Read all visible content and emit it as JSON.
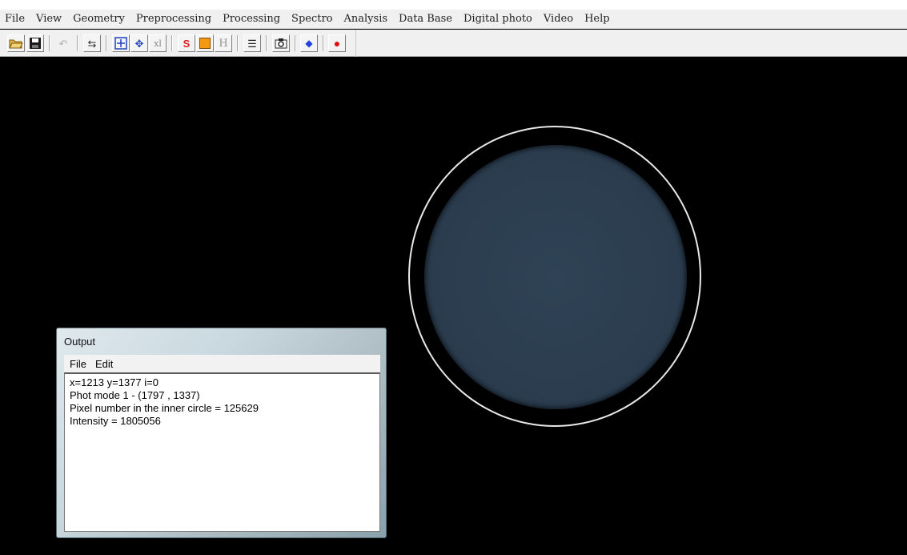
{
  "menubar": {
    "items": [
      "File",
      "View",
      "Geometry",
      "Preprocessing",
      "Processing",
      "Spectro",
      "Analysis",
      "Data Base",
      "Digital photo",
      "Video",
      "Help"
    ]
  },
  "toolbar": {
    "buttons": [
      {
        "name": "open-folder-icon"
      },
      {
        "name": "save-icon"
      },
      {
        "name": "undo-icon",
        "label": "↶"
      },
      {
        "name": "adjust-icon",
        "label": "⇆"
      },
      {
        "name": "zoom-fit-icon"
      },
      {
        "name": "move-icon",
        "label": "✥"
      },
      {
        "name": "xl-icon",
        "label": "xl"
      },
      {
        "name": "red-s-icon",
        "label": "S"
      },
      {
        "name": "orange-square-icon"
      },
      {
        "name": "h-icon",
        "label": "H"
      },
      {
        "name": "list-icon",
        "label": "☰"
      },
      {
        "name": "camera-icon"
      },
      {
        "name": "blue-point-icon",
        "label": "◆"
      },
      {
        "name": "red-point-icon",
        "label": "●"
      }
    ]
  },
  "output_window": {
    "title": "Output",
    "menu": [
      "File",
      "Edit"
    ],
    "lines": [
      "x=1213  y=1377  i=0",
      "Phot mode 1  -  (1797 , 1337)",
      "Pixel number in the inner circle = 125629",
      "Intensity = 1805056"
    ]
  },
  "colors": {
    "disc": "#2b3d4f",
    "ring": "#e8e8e8",
    "background": "#000000"
  }
}
